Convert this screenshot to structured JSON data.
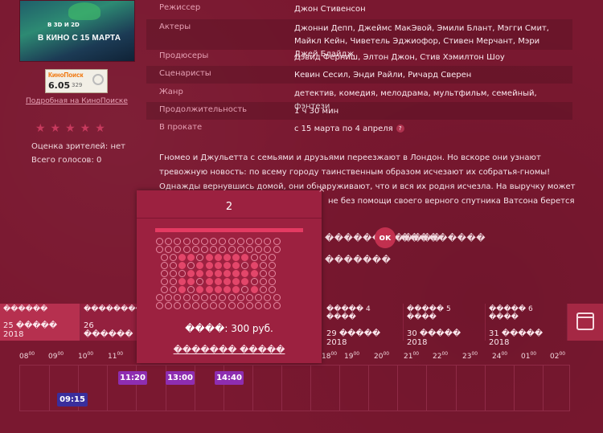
{
  "poster": {
    "caption_small": "В 3D И 2D",
    "caption_big": "В КИНО С 15 МАРТА"
  },
  "kinopoisk": {
    "logo": "КиноПоиск",
    "rating": "6.05",
    "votes": "329",
    "link": "Подробная на КиноПоиске"
  },
  "rating": {
    "stars": "★★★★★",
    "audience": "Оценка зрителей: нет",
    "total": "Всего голосов: 0"
  },
  "details": [
    {
      "key": "Режиссер",
      "value": "Джон Стивенсон"
    },
    {
      "key": "Актеры",
      "value": "Джонни Депп, Джеймс МакЭвой, Эмили Блант, Мэгги Смит, Майкл Кейн, Чиветель Эджиофор, Стивен Мерчант, Мэри Джей Блайдж"
    },
    {
      "key": "Продюсеры",
      "value": "Дэвид Ферниш, Элтон Джон, Стив Хэмилтон Шоу"
    },
    {
      "key": "Сценаристы",
      "value": "Кевин Сесил, Энди Райли, Ричард Сверен"
    },
    {
      "key": "Жанр",
      "value": "детектив, комедия, мелодрама, мультфильм, семейный, фэнтези"
    },
    {
      "key": "Продолжительность",
      "value": "1 ч 30 мин"
    },
    {
      "key": "В прокате",
      "value": "с 15 марта по 4 апреля"
    }
  ],
  "description": {
    "line1": "Гномео и Джульетта с семьями и друзьями переезжают в Лондон. Но вскоре они узнают",
    "line2": "тревожную новость: по всему городу таинственным образом исчезают их собратья-гномы!",
    "line3": "Однажды вернувшись домой, они обнаруживают, что и вся их родня исчезла. На выручку может",
    "line4": "не без помощи своего верного спутника Ватсона берется"
  },
  "garbled": {
    "left_top": "������ ������",
    "right_top": "���������",
    "left_mid": "�������",
    "ok": "ок"
  },
  "days": [
    {
      "l1": "������",
      "l2": "25 ����� 2018"
    },
    {
      "l1": "������������",
      "l2": "26 ������"
    },
    {
      "l1": "����� 4 ����",
      "l2": "29 ����� 2018"
    },
    {
      "l1": "����� 5 ����",
      "l2": "30 ����� 2018"
    },
    {
      "l1": "����� 6 ����",
      "l2": "31 ����� 2018"
    }
  ],
  "hours": [
    "08",
    "09",
    "10",
    "11",
    "18",
    "19",
    "20",
    "21",
    "22",
    "23",
    "24",
    "01",
    "02"
  ],
  "hour_sup": "00",
  "slots": [
    {
      "label": "11:20",
      "kind": "purple"
    },
    {
      "label": "13:00",
      "kind": "purple"
    },
    {
      "label": "14:40",
      "kind": "purple"
    },
    {
      "label": "09:15",
      "kind": "blue"
    }
  ],
  "modal": {
    "hall": "2",
    "close": "×",
    "price": "����: 300 руб.",
    "buy": "������� �����"
  }
}
